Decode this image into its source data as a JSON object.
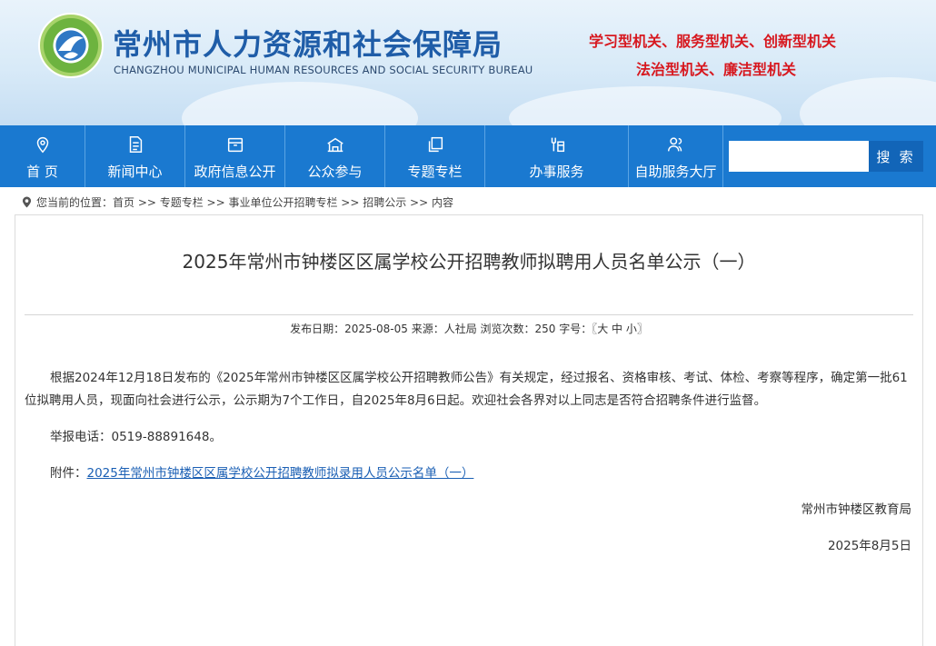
{
  "header": {
    "logo_text": "常州市人力资源和社会保障局",
    "title_cn": "常州市人力资源和社会保障局",
    "title_en": "CHANGZHOU MUNICIPAL HUMAN RESOURCES AND SOCIAL SECURITY BUREAU",
    "slogan_line1": "学习型机关、服务型机关、创新型机关",
    "slogan_line2": "法治型机关、廉洁型机关",
    "accent_color": "#1a79d0",
    "slogan_color": "#d7181f"
  },
  "nav": {
    "items": [
      {
        "label": "首 页",
        "icon": "location-pin-icon"
      },
      {
        "label": "新闻中心",
        "icon": "document-icon"
      },
      {
        "label": "政府信息公开",
        "icon": "briefcase-icon"
      },
      {
        "label": "公众参与",
        "icon": "building-icon"
      },
      {
        "label": "专题专栏",
        "icon": "copy-icon"
      },
      {
        "label": "办事服务",
        "icon": "service-icon"
      },
      {
        "label": "自助服务大厅",
        "icon": "users-icon"
      }
    ],
    "search_placeholder": "",
    "search_button": "搜 索"
  },
  "breadcrumb": {
    "text": "您当前的位置：首页 >> 专题专栏 >> 事业单位公开招聘专栏 >> 招聘公示 >> 内容"
  },
  "article": {
    "title": "2025年常州市钟楼区区属学校公开招聘教师拟聘用人员名单公示（一）",
    "meta": "发布日期：2025-08-05   来源：人社局   浏览次数：250 字号：〖大 中 小〗",
    "paragraph1": "根据2024年12月18日发布的《2025年常州市钟楼区区属学校公开招聘教师公告》有关规定，经过报名、资格审核、考试、体检、考察等程序，确定第一批61位拟聘用人员，现面向社会进行公示，公示期为7个工作日，自2025年8月6日起。欢迎社会各界对以上同志是否符合招聘条件进行监督。",
    "paragraph2": "举报电话：0519-88891648。",
    "attachment_label": "附件：",
    "attachment_link": "2025年常州市钟楼区区属学校公开招聘教师拟录用人员公示名单（一）",
    "signature": "常州市钟楼区教育局",
    "date": "2025年8月5日"
  }
}
